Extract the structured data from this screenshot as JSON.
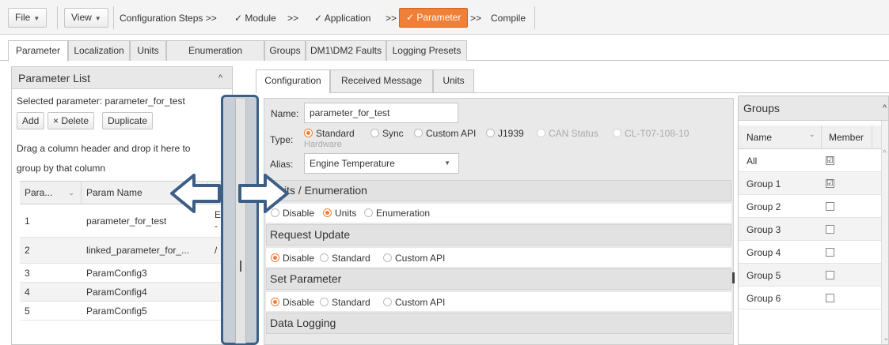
{
  "toolbar": {
    "file_label": "File",
    "view_label": "View",
    "steps_prefix": "Configuration Steps >>",
    "step_module": "✓ Module",
    "sep1": ">>",
    "step_application": "✓ Application",
    "sep2": ">>",
    "step_parameter": "✓ Parameter",
    "sep3": ">>",
    "step_compile": "Compile"
  },
  "main_tabs": [
    "Parameter",
    "Localization",
    "Units",
    "Enumeration",
    "Groups",
    "DM1\\DM2 Faults",
    "Logging Presets"
  ],
  "parameter_list": {
    "title": "Parameter List",
    "selected_text": "Selected parameter: parameter_for_test",
    "buttons": {
      "add": "Add",
      "delete": "× Delete",
      "duplicate": "Duplicate"
    },
    "group_hint_line1": "Drag a column header and drop it here to",
    "group_hint_line2": "group by that column",
    "columns": {
      "para": "Para...",
      "name": "Param Name"
    },
    "rows": [
      {
        "id": "1",
        "name": "parameter_for_test",
        "extra1": "E",
        "extra2": "-"
      },
      {
        "id": "2",
        "name": "linked_parameter_for_...",
        "extra1": "/",
        "extra2": ""
      },
      {
        "id": "3",
        "name": "ParamConfig3",
        "extra1": "",
        "extra2": ""
      },
      {
        "id": "4",
        "name": "ParamConfig4",
        "extra1": "",
        "extra2": ""
      },
      {
        "id": "5",
        "name": "ParamConfig5",
        "extra1": "",
        "extra2": ""
      }
    ]
  },
  "sub_tabs": [
    "Configuration",
    "Received Message",
    "Units"
  ],
  "config": {
    "name_label": "Name:",
    "name_value": "parameter_for_test",
    "type_label": "Type:",
    "type_options": [
      "Standard",
      "Sync",
      "Custom API",
      "J1939",
      "CAN Status",
      "CL-T07-108-10"
    ],
    "type_continuation": "Hardware",
    "alias_label": "Alias:",
    "alias_value": "Engine Temperature",
    "sections": {
      "units_enum": "Units / Enumeration",
      "request_update": "Request Update",
      "set_parameter": "Set Parameter",
      "data_logging": "Data Logging"
    },
    "units_options": [
      "Disable",
      "Units",
      "Enumeration"
    ],
    "request_options": [
      "Disable",
      "Standard",
      "Custom API"
    ],
    "set_options": [
      "Disable",
      "Standard",
      "Custom API"
    ]
  },
  "groups": {
    "title": "Groups",
    "col_name": "Name",
    "col_member": "Member",
    "rows": [
      {
        "name": "All",
        "member": "☑"
      },
      {
        "name": "Group 1",
        "member": "☑"
      },
      {
        "name": "Group 2",
        "member": ""
      },
      {
        "name": "Group 3",
        "member": ""
      },
      {
        "name": "Group 4",
        "member": ""
      },
      {
        "name": "Group 5",
        "member": ""
      },
      {
        "name": "Group 6",
        "member": ""
      }
    ]
  },
  "colors": {
    "accent": "#f07f38",
    "highlight_border": "#3d5f86"
  }
}
